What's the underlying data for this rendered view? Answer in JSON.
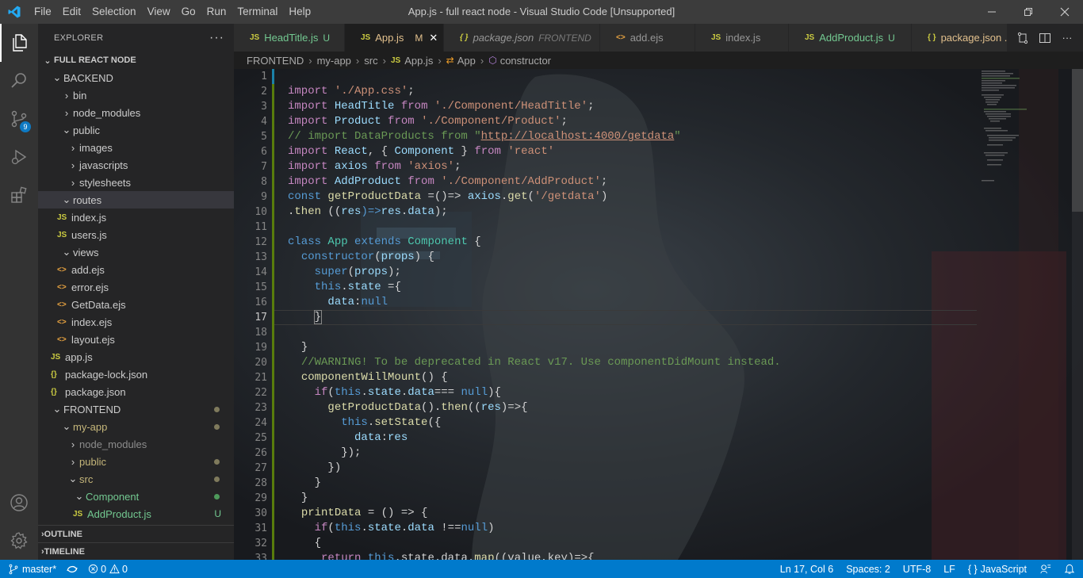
{
  "titlebar": {
    "menu": [
      "File",
      "Edit",
      "Selection",
      "View",
      "Go",
      "Run",
      "Terminal",
      "Help"
    ],
    "title": "App.js - full react node - Visual Studio Code [Unsupported]"
  },
  "activitybar": {
    "scm_badge": "9"
  },
  "sidebar": {
    "header": "EXPLORER",
    "root": "FULL REACT NODE",
    "outline": "OUTLINE",
    "timeline": "TIMELINE",
    "tree": [
      {
        "label": "BACKEND",
        "kind": "folder-open"
      },
      {
        "label": "bin",
        "kind": "folder"
      },
      {
        "label": "node_modules",
        "kind": "folder"
      },
      {
        "label": "public",
        "kind": "folder-open"
      },
      {
        "label": "images",
        "kind": "folder"
      },
      {
        "label": "javascripts",
        "kind": "folder"
      },
      {
        "label": "stylesheets",
        "kind": "folder"
      },
      {
        "label": "routes",
        "kind": "folder-open"
      },
      {
        "label": "index.js",
        "kind": "js"
      },
      {
        "label": "users.js",
        "kind": "js"
      },
      {
        "label": "views",
        "kind": "folder-open"
      },
      {
        "label": "add.ejs",
        "kind": "ejs"
      },
      {
        "label": "error.ejs",
        "kind": "ejs"
      },
      {
        "label": "GetData.ejs",
        "kind": "ejs"
      },
      {
        "label": "index.ejs",
        "kind": "ejs"
      },
      {
        "label": "layout.ejs",
        "kind": "ejs"
      },
      {
        "label": "app.js",
        "kind": "js"
      },
      {
        "label": "package-lock.json",
        "kind": "json"
      },
      {
        "label": "package.json",
        "kind": "json"
      },
      {
        "label": "FRONTEND",
        "kind": "folder-open"
      },
      {
        "label": "my-app",
        "kind": "folder-open"
      },
      {
        "label": "node_modules",
        "kind": "folder"
      },
      {
        "label": "public",
        "kind": "folder"
      },
      {
        "label": "src",
        "kind": "folder-open"
      },
      {
        "label": "Component",
        "kind": "folder-open"
      },
      {
        "label": "AddProduct.js",
        "kind": "js",
        "status": "U"
      }
    ]
  },
  "tabs": [
    {
      "icon": "JS",
      "label": "HeadTitle.js",
      "status": "U"
    },
    {
      "icon": "JS",
      "label": "App.js",
      "status": "M"
    },
    {
      "icon": "{ }",
      "label": "package.json",
      "desc": "FRONTEND"
    },
    {
      "icon": "<>",
      "label": "add.ejs"
    },
    {
      "icon": "JS",
      "label": "index.js"
    },
    {
      "icon": "JS",
      "label": "AddProduct.js",
      "status": "U"
    },
    {
      "icon": "{ }",
      "label": "package.json ..."
    }
  ],
  "breadcrumb": [
    "FRONTEND",
    "my-app",
    "src",
    "App.js",
    "App",
    "constructor"
  ],
  "editor": {
    "line_numbers": [
      "1",
      "2",
      "3",
      "4",
      "5",
      "6",
      "7",
      "8",
      "9",
      "10",
      "11",
      "12",
      "13",
      "14",
      "15",
      "16",
      "17",
      "18",
      "19",
      "20",
      "21",
      "22",
      "23",
      "24",
      "25",
      "26",
      "27",
      "28",
      "29",
      "30",
      "31",
      "32",
      "33"
    ],
    "current_line": "17",
    "code": {
      "l2_a": "import",
      "l2_b": "'./App.css'",
      "l2_c": ";",
      "l3_a": "import",
      "l3_b": "HeadTitle",
      "l3_c": "from",
      "l3_d": "'./Component/HeadTitle'",
      "l3_e": ";",
      "l4_a": "import",
      "l4_b": "Product",
      "l4_c": "from",
      "l4_d": "'./Component/Product'",
      "l4_e": ";",
      "l5_a": "// import DataProducts from \"",
      "l5_b": "http://localhost:4000/getdata",
      "l5_c": "\"",
      "l6_a": "import",
      "l6_b": "React",
      "l6_c": ", {",
      "l6_d": "Component",
      "l6_e": "}",
      "l6_f": "from",
      "l6_g": "'react'",
      "l7_a": "import",
      "l7_b": "axios",
      "l7_c": "from",
      "l7_d": "'axios'",
      "l7_e": ";",
      "l8_a": "import",
      "l8_b": "AddProduct",
      "l8_c": "from",
      "l8_d": "'./Component/AddProduct'",
      "l8_e": ";",
      "l9_a": "const",
      "l9_b": "getProductData",
      "l9_c": "=()=>",
      "l9_d": "axios",
      "l9_e": ".",
      "l9_f": "get",
      "l9_g": "(",
      "l9_h": "'/getdata'",
      "l9_i": ")",
      "l10_a": ".",
      "l10_b": "then",
      "l10_c": " ((",
      "l10_d": "res",
      "l10_e": ")=>",
      "l10_f": "res",
      "l10_g": ".",
      "l10_h": "data",
      "l10_i": ");",
      "l12_a": "class",
      "l12_b": "App",
      "l12_c": "extends",
      "l12_d": "Component",
      "l12_e": "{",
      "l13_a": "constructor",
      "l13_b": "(",
      "l13_c": "props",
      "l13_d": ") {",
      "l14_a": "super",
      "l14_b": "(",
      "l14_c": "props",
      "l14_d": ");",
      "l15_a": "this",
      "l15_b": ".",
      "l15_c": "state",
      "l15_d": " ={",
      "l16_a": "data",
      "l16_b": ":",
      "l16_c": "null",
      "l17_a": "}",
      "l19_a": "}",
      "l20_a": "//WARNING! To be deprecated in React v17. Use componentDidMount instead.",
      "l21_a": "componentWillMount",
      "l21_b": "() {",
      "l22_a": "if",
      "l22_b": "(",
      "l22_c": "this",
      "l22_d": ".",
      "l22_e": "state",
      "l22_f": ".",
      "l22_g": "data",
      "l22_h": "===",
      "l22_i": "null",
      "l22_j": "){",
      "l23_a": "getProductData",
      "l23_b": "().",
      "l23_c": "then",
      "l23_d": "((",
      "l23_e": "res",
      "l23_f": ")=>{",
      "l24_a": "this",
      "l24_b": ".",
      "l24_c": "setState",
      "l24_d": "({",
      "l25_a": "data",
      "l25_b": ":",
      "l25_c": "res",
      "l26_a": "});",
      "l27_a": "})",
      "l28_a": "}",
      "l29_a": "}",
      "l30_a": "printData",
      "l30_b": " = () =>",
      "l30_c": " {",
      "l31_a": "if",
      "l31_b": "(",
      "l31_c": "this",
      "l31_d": ".",
      "l31_e": "state",
      "l31_f": ".",
      "l31_g": "data",
      "l31_h": " !==",
      "l31_i": "null",
      "l31_j": ")",
      "l32_a": "{",
      "l33_a": "return",
      "l33_b": "this",
      "l33_c": ".state.data.",
      "l33_d": "map",
      "l33_e": "((value,key)=>{"
    }
  },
  "statusbar": {
    "branch": "master*",
    "errors": "0",
    "warnings": "0",
    "position": "Ln 17, Col 6",
    "spaces": "Spaces: 2",
    "encoding": "UTF-8",
    "eol": "LF",
    "language": "JavaScript"
  },
  "colors": {
    "activity_bar": "#333333",
    "sidebar": "#252526",
    "editor": "#1e1e1e",
    "statusbar": "#007acc",
    "untracked": "#73c991",
    "modified": "#e2c08d"
  }
}
